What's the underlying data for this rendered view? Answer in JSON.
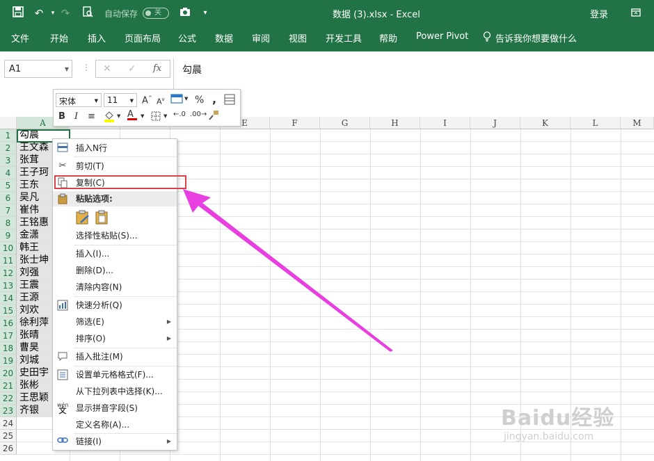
{
  "window": {
    "title": "数据 (3).xlsx  -  Excel",
    "login": "登录"
  },
  "qat": {
    "autosave_label": "自动保存",
    "autosave_state": "关"
  },
  "ribbon_tabs": [
    "文件",
    "开始",
    "插入",
    "页面布局",
    "公式",
    "数据",
    "审阅",
    "视图",
    "开发工具",
    "帮助",
    "Power Pivot",
    "告诉我你想要做什么"
  ],
  "name_box": "A1",
  "formula_content": "勾晨",
  "mini_toolbar": {
    "font": "宋体",
    "size": "11"
  },
  "columns": [
    "A",
    "B",
    "C",
    "D",
    "E",
    "F",
    "G",
    "H",
    "I",
    "J",
    "K",
    "L",
    "M"
  ],
  "rows": [
    "1",
    "2",
    "3",
    "4",
    "5",
    "6",
    "7",
    "8",
    "9",
    "10",
    "11",
    "12",
    "13",
    "14",
    "15",
    "16",
    "17",
    "18",
    "19",
    "20",
    "21",
    "22",
    "23",
    "24",
    "25",
    "26"
  ],
  "cells_a": [
    "勾晨",
    "王文森",
    "张茸",
    "王子珂",
    "王东",
    "吴凡",
    "崔伟",
    "王铭惠",
    "金潇",
    "韩王",
    "张士坤",
    "刘强",
    "王震",
    "王源",
    "刘欢",
    "徐利萍",
    "张晴",
    "曹昊",
    "刘城",
    "史田宇",
    "张彬",
    "王思颖",
    "齐银"
  ],
  "context_menu": {
    "insert_row": "插入N行",
    "cut": "剪切(T)",
    "copy": "复制(C)",
    "paste_options": "粘贴选项:",
    "paste_special": "选择性粘贴(S)...",
    "insert": "插入(I)...",
    "delete": "删除(D)...",
    "clear": "清除内容(N)",
    "quick_analysis": "快速分析(Q)",
    "filter": "筛选(E)",
    "sort": "排序(O)",
    "insert_comment": "插入批注(M)",
    "format_cells": "设置单元格格式(F)...",
    "pick_list": "从下拉列表中选择(K)...",
    "phonetic": "显示拼音字段(S)",
    "define_name": "定义名称(A)...",
    "link": "链接(I)"
  },
  "watermark": {
    "brand": "Baidu经验",
    "url": "jingyan.baidu.com"
  },
  "colors": {
    "excel_green": "#217346",
    "highlight_red": "#d9424a",
    "arrow_magenta": "#e83fe0"
  }
}
